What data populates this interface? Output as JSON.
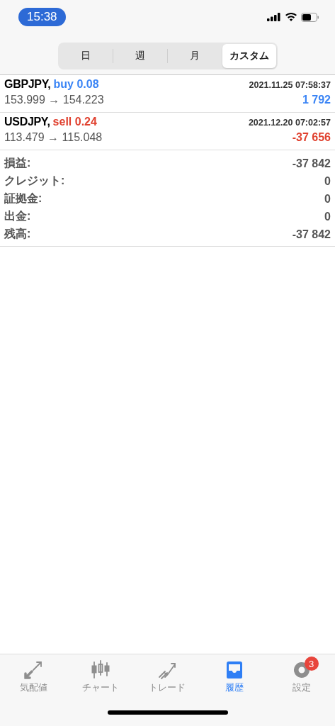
{
  "status_bar": {
    "time": "15:38"
  },
  "period_tabs": [
    {
      "label": "日",
      "selected": false
    },
    {
      "label": "週",
      "selected": false
    },
    {
      "label": "月",
      "selected": false
    },
    {
      "label": "カスタム",
      "selected": true
    }
  ],
  "deals": [
    {
      "symbol": "GBPJPY,",
      "action": {
        "text": "buy 0.08",
        "color": "#3a84f5"
      },
      "time": "2021.11.25 07:58:37",
      "prices": "153.999 → 154.223",
      "profit": {
        "text": "1 792",
        "color": "#3a84f5"
      }
    },
    {
      "symbol": "USDJPY,",
      "action": {
        "text": "sell 0.24",
        "color": "#e0412f"
      },
      "time": "2021.12.20 07:02:57",
      "prices": "113.479 → 115.048",
      "profit": {
        "text": "-37 656",
        "color": "#e0412f"
      }
    }
  ],
  "summary": [
    {
      "label": "損益:",
      "value": "-37 842"
    },
    {
      "label": "クレジット:",
      "value": "0"
    },
    {
      "label": "証拠金:",
      "value": "0"
    },
    {
      "label": "出金:",
      "value": "0"
    },
    {
      "label": "残高:",
      "value": "-37 842"
    }
  ],
  "tab_bar": [
    {
      "kind": "quotes",
      "label": "気配値",
      "selected": false
    },
    {
      "kind": "chart",
      "label": "チャート",
      "selected": false
    },
    {
      "kind": "trade",
      "label": "トレード",
      "selected": false
    },
    {
      "kind": "history",
      "label": "履歴",
      "selected": true
    },
    {
      "kind": "settings",
      "label": "設定",
      "selected": false,
      "badge": "3"
    }
  ]
}
